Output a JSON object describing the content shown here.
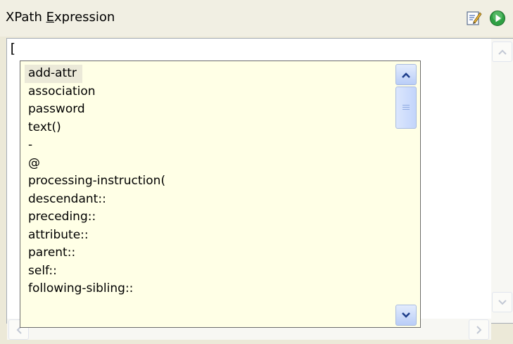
{
  "header": {
    "title_prefix": "XPath ",
    "title_mnemonic": "E",
    "title_suffix": "xpression",
    "edit_icon": "edit-icon",
    "run_icon": "run-icon",
    "run_color": "#2ea043"
  },
  "editor": {
    "value": "["
  },
  "autocomplete": {
    "selected_index": 0,
    "items": [
      "add-attr",
      "association",
      "password",
      "text()",
      "-",
      "@",
      "processing-instruction(",
      "descendant::",
      "preceding::",
      "attribute::",
      "parent::",
      "self::",
      "following-sibling::"
    ]
  },
  "colors": {
    "popup_bg": "#ffffe6",
    "selection_bg": "#ebe9d8",
    "scrollbar_blue": "#c3d5fb"
  }
}
